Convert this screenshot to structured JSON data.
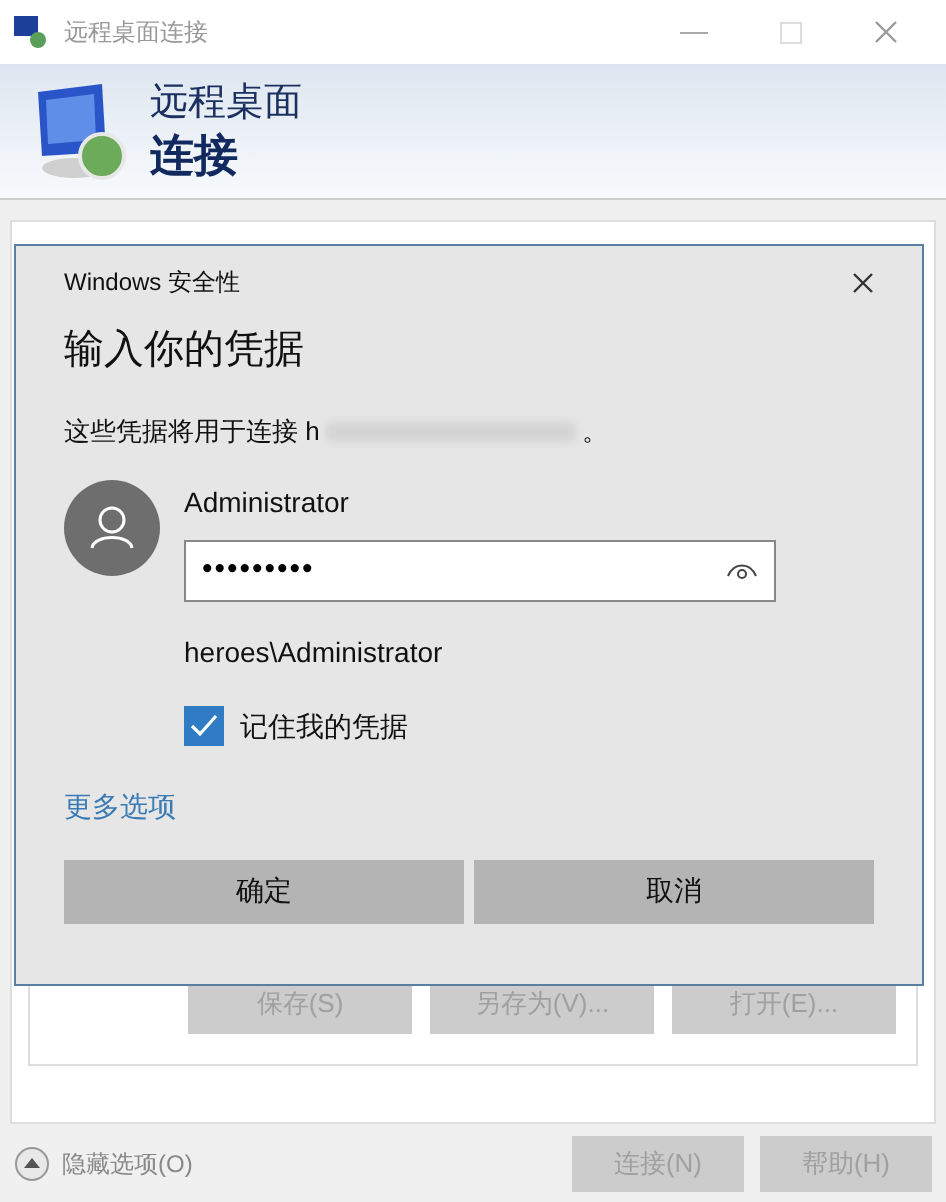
{
  "window": {
    "title": "远程桌面连接"
  },
  "banner": {
    "line_1": "远程桌面",
    "line_2": "连接"
  },
  "background_buttons": [
    {
      "label": "保存(S)",
      "disabled": true
    },
    {
      "label": "另存为(V)...",
      "disabled": true
    },
    {
      "label": "打开(E)...",
      "disabled": true
    }
  ],
  "options_toggle": {
    "label": "隐藏选项(O)"
  },
  "footer_buttons": [
    {
      "label": "连接(N)",
      "disabled": true
    },
    {
      "label": "帮助(H)",
      "disabled": true
    }
  ],
  "dialog": {
    "caption": "Windows 安全性",
    "title": "输入你的凭据",
    "message": "这些凭据将用于连接 h",
    "message_end": "。",
    "username": "Administrator",
    "password": "•••••••••",
    "account": "heroes\\Administrator",
    "remember": {
      "label": "记住我的凭据",
      "checked": true
    },
    "more_options": "更多选项",
    "buttons": [
      "确定",
      "取消"
    ]
  }
}
